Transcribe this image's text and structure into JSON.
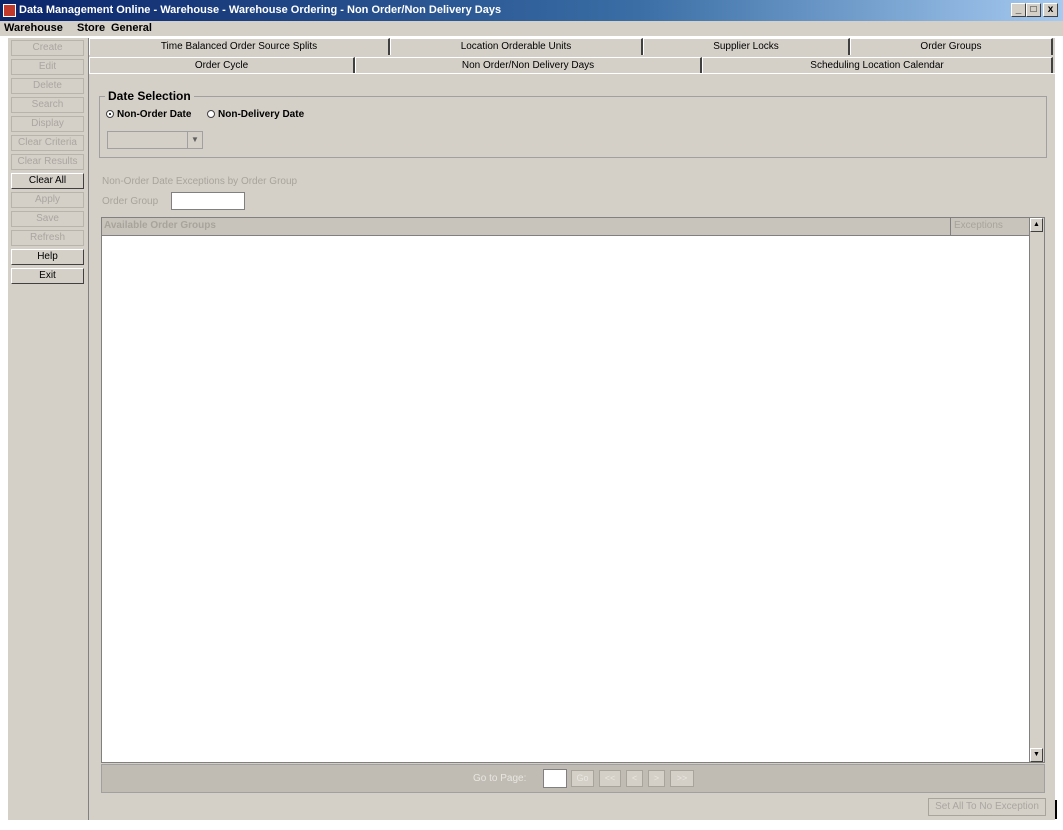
{
  "window": {
    "title": "Data Management Online - Warehouse - Warehouse Ordering - Non Order/Non Delivery Days",
    "minimize": "_",
    "maximize": "□",
    "close": "x"
  },
  "menu": [
    "Warehouse",
    "Store",
    "General"
  ],
  "sidebar": {
    "buttons": [
      {
        "label": "Create",
        "enabled": false
      },
      {
        "label": "Edit",
        "enabled": false
      },
      {
        "label": "Delete",
        "enabled": false
      },
      {
        "label": "Search",
        "enabled": false
      },
      {
        "label": "Display",
        "enabled": false
      },
      {
        "label": "Clear Criteria",
        "enabled": false
      },
      {
        "label": "Clear Results",
        "enabled": false
      },
      {
        "label": "Clear All",
        "enabled": true
      },
      {
        "label": "Apply",
        "enabled": false
      },
      {
        "label": "Save",
        "enabled": false
      },
      {
        "label": "Refresh",
        "enabled": false
      },
      {
        "label": "Help",
        "enabled": true
      },
      {
        "label": "Exit",
        "enabled": true
      }
    ]
  },
  "tabs": {
    "row1": [
      "Time Balanced Order Source Splits",
      "Location Orderable Units",
      "Supplier Locks",
      "Order Groups"
    ],
    "row2": [
      "Order Cycle",
      "Non Order/Non Delivery Days",
      "Scheduling Location Calendar"
    ],
    "selected": "Non Order/Non Delivery Days"
  },
  "date_selection": {
    "legend": "Date Selection",
    "options": [
      "Non-Order Date",
      "Non-Delivery Date"
    ],
    "selected": "Non-Order Date",
    "dropdown_value": ""
  },
  "exceptions": {
    "section_label": "Non-Order Date Exceptions by Order Group",
    "order_group_label": "Order Group",
    "order_group_value": ""
  },
  "grid": {
    "columns": [
      "Available Order Groups",
      "Exceptions"
    ],
    "rows": []
  },
  "pager": {
    "label": "Go to Page:",
    "page_value": "",
    "go": "Go",
    "first": "<<",
    "prev": "<",
    "next": ">",
    "last": ">>"
  },
  "set_all_button": "Set All To No Exception"
}
